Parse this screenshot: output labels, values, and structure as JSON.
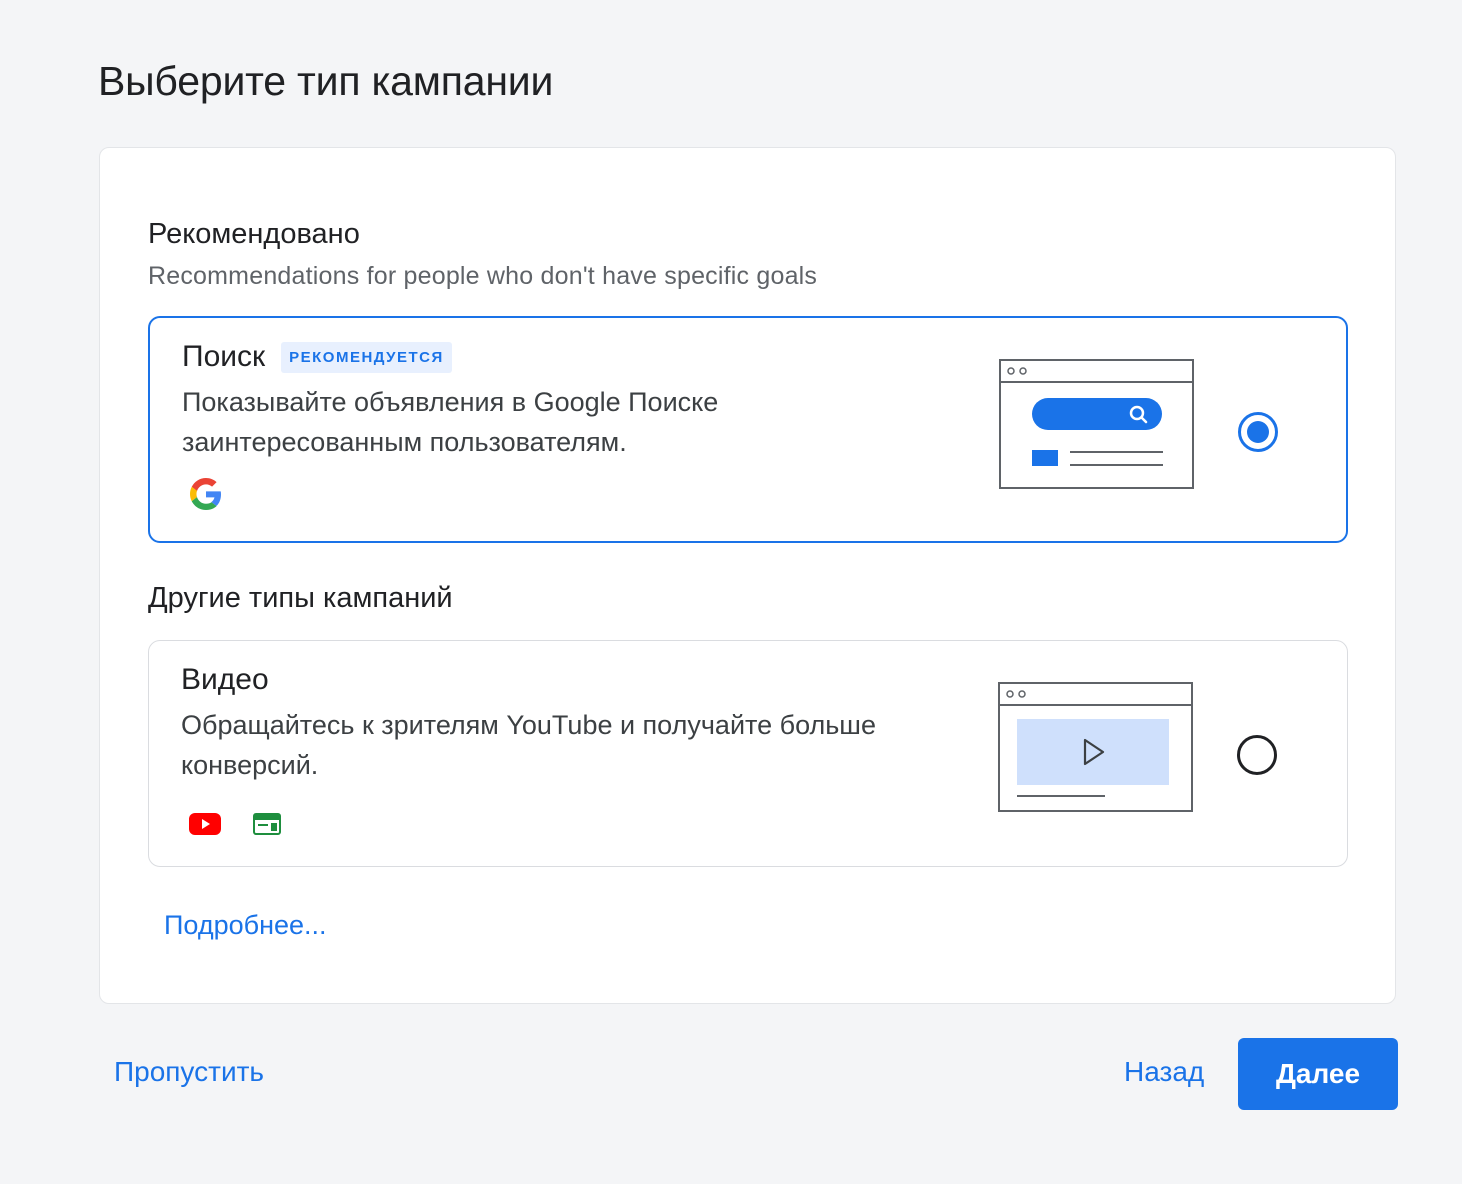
{
  "page_title": "Выберите тип кампании",
  "recommended": {
    "title": "Рекомендовано",
    "subtitle": "Recommendations for people who don't have specific goals"
  },
  "search_option": {
    "name": "Поиск",
    "badge": "РЕКОМЕНДУЕТСЯ",
    "description": "Показывайте объявления в Google Поиске заинтересованным пользователям.",
    "selected": true,
    "icons": [
      "google-g-icon"
    ]
  },
  "other": {
    "title": "Другие типы кампаний"
  },
  "video_option": {
    "name": "Видео",
    "description": "Обращайтесь к зрителям YouTube и получайте больше конверсий.",
    "selected": false,
    "icons": [
      "youtube-icon",
      "display-network-icon"
    ]
  },
  "more_link": "Подробнее...",
  "footer": {
    "skip": "Пропустить",
    "back": "Назад",
    "next": "Далее"
  },
  "colors": {
    "accent": "#1a73e8",
    "badge_bg": "#e8f0fe",
    "youtube_red": "#ff0000",
    "display_green": "#1e8e3e"
  }
}
